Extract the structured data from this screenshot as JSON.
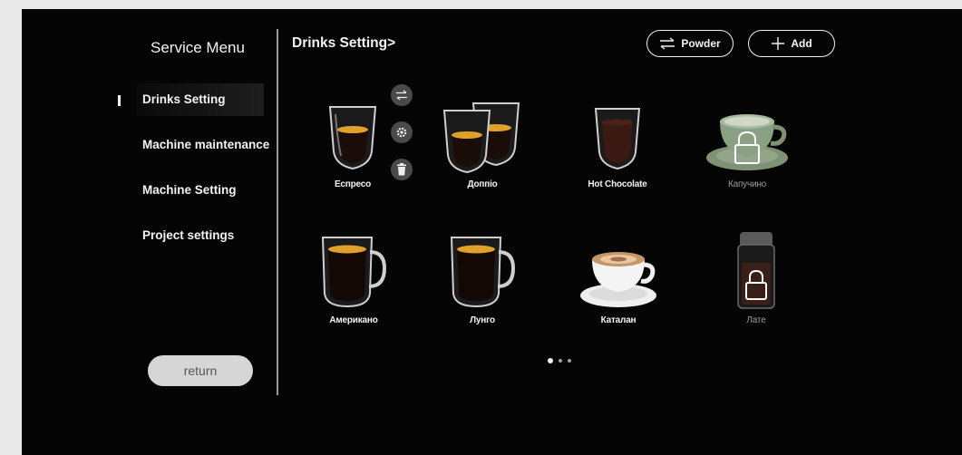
{
  "sidebar": {
    "title": "Service Menu",
    "items": [
      {
        "label": "Drinks Setting",
        "active": true
      },
      {
        "label": "Machine maintenance",
        "active": false
      },
      {
        "label": "Machine Setting",
        "active": false
      },
      {
        "label": "Project settings",
        "active": false
      }
    ],
    "return_label": "return"
  },
  "header": {
    "title": "Drinks Setting>",
    "powder_label": "Powder",
    "add_label": "Add"
  },
  "drinks": [
    {
      "name": "Еспресо",
      "locked": false,
      "icon": "espresso-glass-icon"
    },
    {
      "name": "Доппіо",
      "locked": false,
      "icon": "doppio-glasses-icon"
    },
    {
      "name": "Hot Chocolate",
      "locked": false,
      "icon": "hot-chocolate-glass-icon"
    },
    {
      "name": "Капучино",
      "locked": true,
      "icon": "cappuccino-cup-icon"
    },
    {
      "name": "Американо",
      "locked": false,
      "icon": "americano-mug-icon"
    },
    {
      "name": "Лунго",
      "locked": false,
      "icon": "lungo-mug-icon"
    },
    {
      "name": "Каталан",
      "locked": false,
      "icon": "catalan-cup-icon"
    },
    {
      "name": "Лате",
      "locked": true,
      "icon": "latte-jar-icon"
    }
  ],
  "controls": [
    "swap-icon",
    "gear-icon",
    "trash-icon"
  ],
  "pagination": {
    "pages": 3,
    "current": 1
  },
  "colors": {
    "background": "#050505",
    "text": "#f2f2f2",
    "locked_text": "#9a9a9a",
    "return_button": "#d6d6d6",
    "crema": "#e0a02a"
  }
}
